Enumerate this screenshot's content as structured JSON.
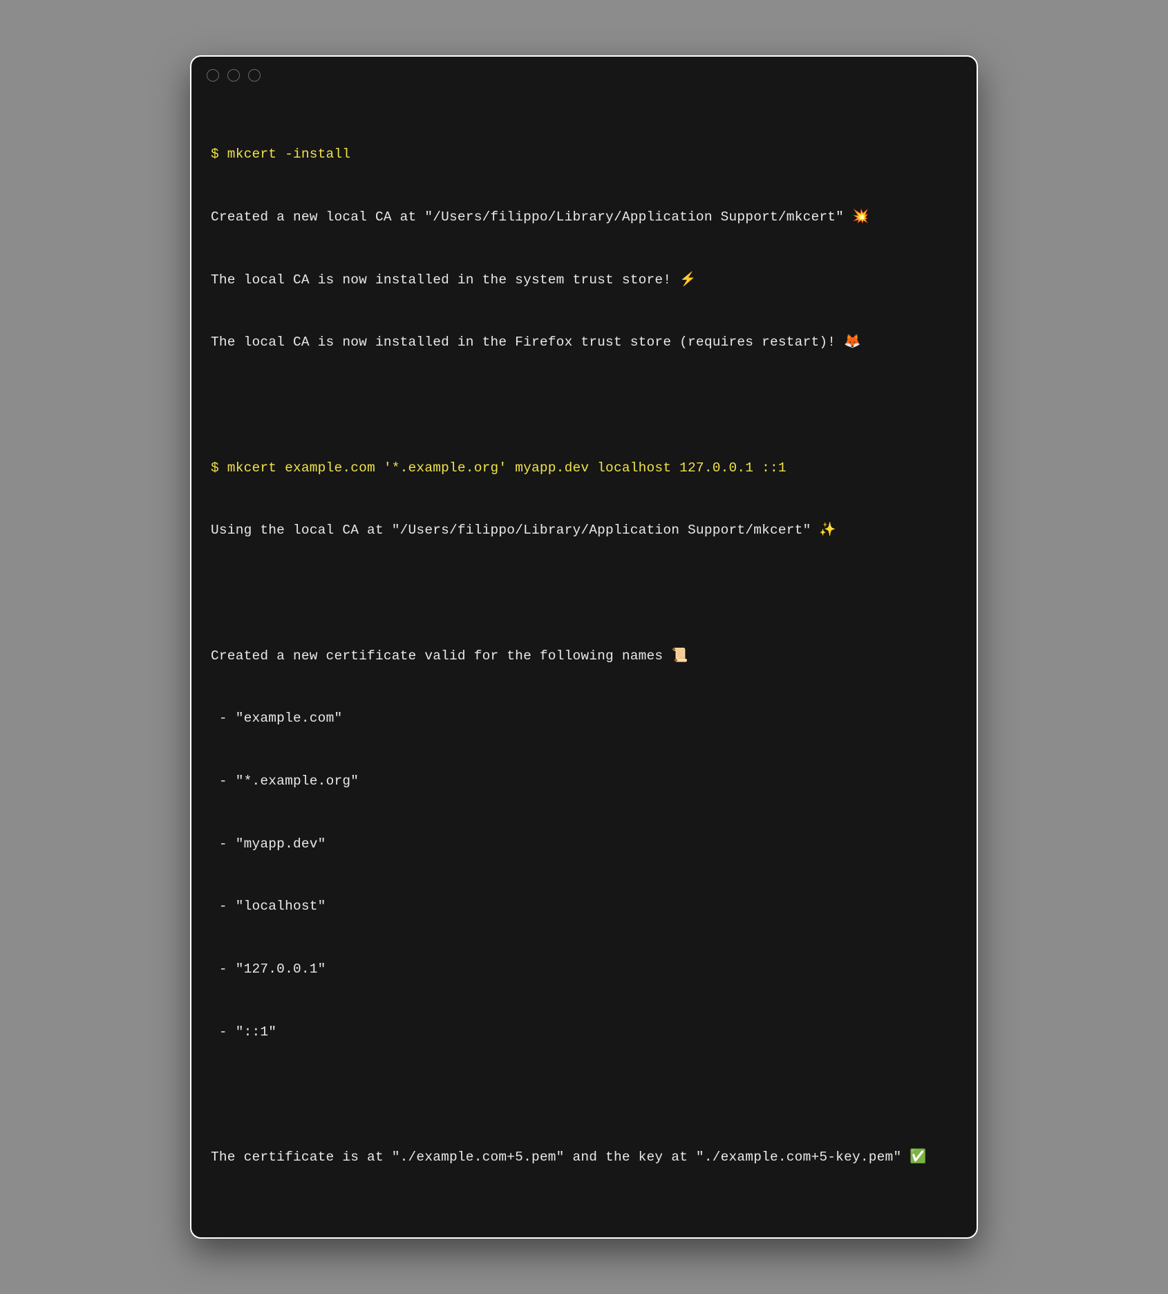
{
  "terminal": {
    "prompt": "$ ",
    "session": [
      {
        "command": "mkcert -install",
        "output": [
          "Created a new local CA at \"/Users/filippo/Library/Application Support/mkcert\" 💥",
          "The local CA is now installed in the system trust store! ⚡️",
          "The local CA is now installed in the Firefox trust store (requires restart)! 🦊"
        ]
      },
      {
        "command": "mkcert example.com '*.example.org' myapp.dev localhost 127.0.0.1 ::1",
        "output": [
          "Using the local CA at \"/Users/filippo/Library/Application Support/mkcert\" ✨",
          "",
          "Created a new certificate valid for the following names 📜",
          " - \"example.com\"",
          " - \"*.example.org\"",
          " - \"myapp.dev\"",
          " - \"localhost\"",
          " - \"127.0.0.1\"",
          " - \"::1\"",
          "",
          "The certificate is at \"./example.com+5.pem\" and the key at \"./example.com+5-key.pem\" ✅"
        ]
      }
    ]
  }
}
